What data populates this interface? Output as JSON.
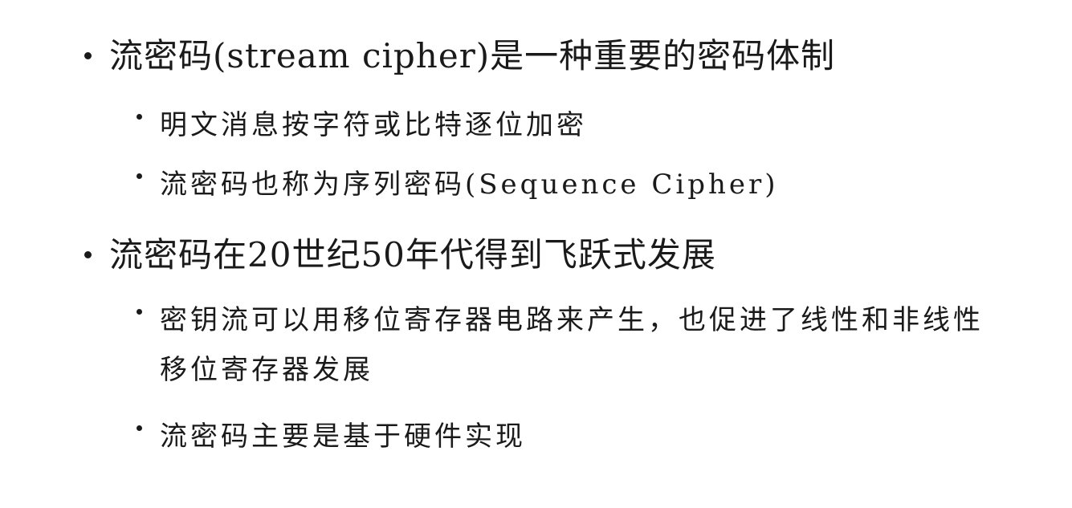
{
  "slide": {
    "bullets": [
      {
        "text": "流密码(stream cipher)是一种重要的密码体制",
        "sub": [
          {
            "text": "明文消息按字符或比特逐位加密"
          },
          {
            "text": "流密码也称为序列密码(Sequence Cipher)"
          }
        ]
      },
      {
        "text": "流密码在20世纪50年代得到飞跃式发展",
        "sub": [
          {
            "text": "密钥流可以用移位寄存器电路来产生，也促进了线性和非线性移位寄存器发展"
          },
          {
            "text": "流密码主要是基于硬件实现"
          }
        ]
      }
    ]
  }
}
